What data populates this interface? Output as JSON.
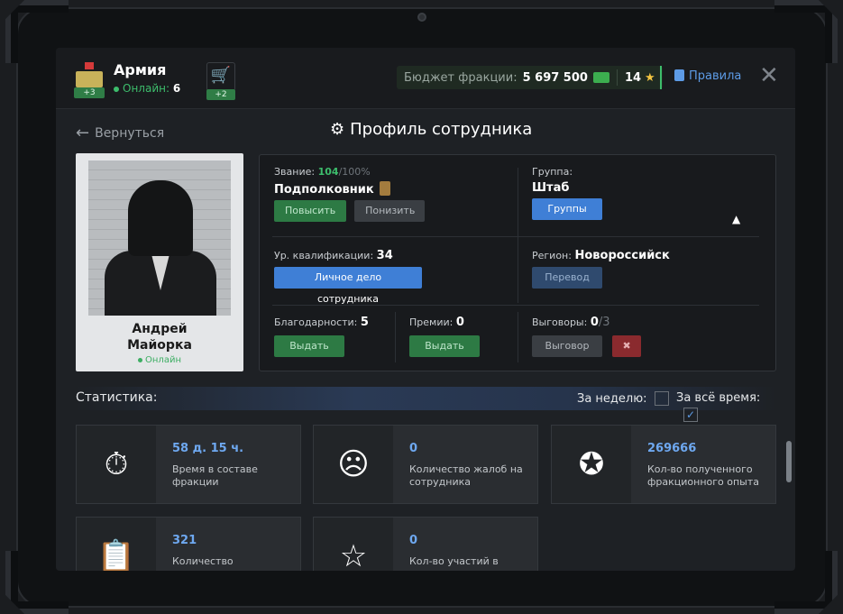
{
  "header": {
    "faction_name": "Армия",
    "online_label": "Онлайн:",
    "online_count": "6",
    "faction_badge": "+3",
    "cart_badge": "+2",
    "budget_label": "Бюджет фракции:",
    "budget_value": "5 697 500",
    "stars_value": "14",
    "rules_label": "Правила"
  },
  "nav": {
    "back_label": "Вернуться",
    "page_title": "Профиль сотрудника"
  },
  "employee": {
    "name_line1": "Андрей",
    "name_line2": "Майорка",
    "status": "Онлайн"
  },
  "info": {
    "rank_label": "Звание:",
    "rank_progress": "104",
    "rank_max": "/100%",
    "rank_name": "Подполковник",
    "promote_btn": "Повысить",
    "demote_btn": "Понизить",
    "group_label": "Группа:",
    "group_name": "Штаб",
    "groups_btn": "Группы",
    "qual_label": "Ур. квалификации:",
    "qual_value": "34",
    "personal_file_btn": "Личное дело сотрудника",
    "region_label": "Регион:",
    "region_name": "Новороссийск",
    "transfer_btn": "Перевод",
    "thanks_label": "Благодарности:",
    "thanks_value": "5",
    "thanks_btn": "Выдать",
    "bonus_label": "Премии:",
    "bonus_value": "0",
    "bonus_btn": "Выдать",
    "reprimand_label": "Выговоры:",
    "reprimand_value": "0",
    "reprimand_max": "/3",
    "reprimand_btn": "Выговор"
  },
  "stats": {
    "label": "Статистика:",
    "week_label": "За неделю:",
    "all_time_label": "За всё время:",
    "week_checked": false,
    "all_time_checked": true,
    "cards": [
      {
        "value": "58 д. 15 ч.",
        "desc": "Время в составе фракции",
        "icon": "stopwatch-icon"
      },
      {
        "value": "0",
        "desc": "Количество жалоб на сотрудника",
        "icon": "complaint-icon"
      },
      {
        "value": "269666",
        "desc": "Кол-во полученного фракционного опыта",
        "icon": "exp-icon"
      },
      {
        "value": "321",
        "desc": "Количество",
        "icon": "clipboard-icon"
      },
      {
        "value": "0",
        "desc": "Кол-во участий в",
        "icon": "star-icon"
      }
    ]
  },
  "colors": {
    "accent_blue": "#3f7fd6",
    "green": "#2d7a44",
    "stat_value": "#6ea8f0"
  }
}
